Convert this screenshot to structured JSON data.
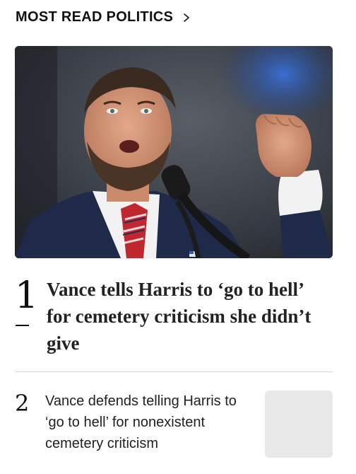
{
  "section": {
    "title": "MOST READ POLITICS",
    "chevron_icon": "chevron-right-icon"
  },
  "hero": {
    "alt": "Man speaking at a microphone with raised fist",
    "colors": {
      "background": "#2b2f36",
      "accent_blue": "#2e5fb8",
      "suit": "#1f2a4a",
      "tie_red": "#c0282f"
    }
  },
  "articles": [
    {
      "rank": "1",
      "headline": "Vance tells Harris to ‘go to hell’ for cemetery criticism she didn’t give"
    },
    {
      "rank": "2",
      "headline": "Vance defends telling Harris to ‘go to hell’ for nonexistent cemetery criticism"
    }
  ]
}
